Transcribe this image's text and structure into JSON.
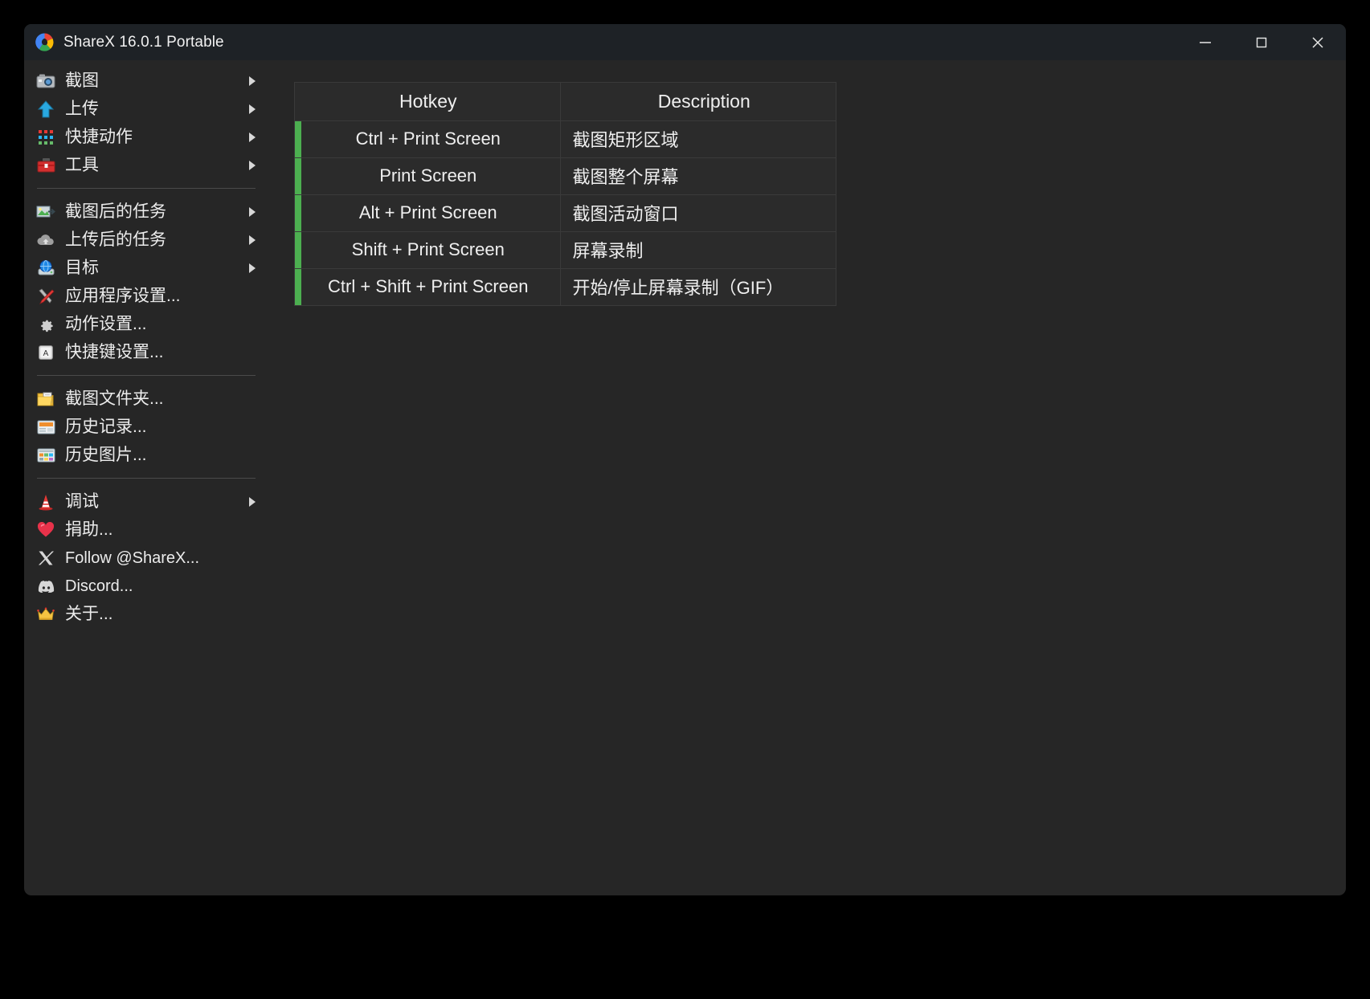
{
  "window": {
    "title": "ShareX 16.0.1 Portable",
    "logo_icon": "sharex-swirl-logo",
    "background_color": "#262626",
    "titlebar_color": "#1e2226",
    "controls": [
      {
        "name": "minimize",
        "icon": "minimize-icon"
      },
      {
        "name": "maximize",
        "icon": "maximize-icon"
      },
      {
        "name": "close",
        "icon": "close-icon"
      }
    ]
  },
  "sidebar": {
    "groups": [
      {
        "items": [
          {
            "label": "截图",
            "icon": "camera-icon",
            "has_submenu": true
          },
          {
            "label": "上传",
            "icon": "upload-arrow-icon",
            "has_submenu": true
          },
          {
            "label": "快捷动作",
            "icon": "color-dots-grid-icon",
            "has_submenu": true
          },
          {
            "label": "工具",
            "icon": "toolbox-icon",
            "has_submenu": true
          }
        ]
      },
      {
        "items": [
          {
            "label": "截图后的任务",
            "icon": "after-capture-icon",
            "has_submenu": true
          },
          {
            "label": "上传后的任务",
            "icon": "cloud-icon",
            "has_submenu": true
          },
          {
            "label": "目标",
            "icon": "destination-globe-icon",
            "has_submenu": true
          },
          {
            "label": "应用程序设置...",
            "icon": "wrench-screwdriver-icon",
            "has_submenu": false
          },
          {
            "label": "动作设置...",
            "icon": "gear-icon",
            "has_submenu": false
          },
          {
            "label": "快捷键设置...",
            "icon": "keyboard-key-icon",
            "has_submenu": false
          }
        ]
      },
      {
        "items": [
          {
            "label": "截图文件夹...",
            "icon": "folder-icon",
            "has_submenu": false
          },
          {
            "label": "历史记录...",
            "icon": "history-list-icon",
            "has_submenu": false
          },
          {
            "label": "历史图片...",
            "icon": "image-history-icon",
            "has_submenu": false
          }
        ]
      },
      {
        "items": [
          {
            "label": "调试",
            "icon": "traffic-cone-icon",
            "has_submenu": true
          },
          {
            "label": "捐助...",
            "icon": "heart-icon",
            "has_submenu": false
          },
          {
            "label": "Follow @ShareX...",
            "icon": "x-twitter-icon",
            "has_submenu": false
          },
          {
            "label": "Discord...",
            "icon": "discord-icon",
            "has_submenu": false
          },
          {
            "label": "关于...",
            "icon": "crown-icon",
            "has_submenu": false
          }
        ]
      }
    ]
  },
  "hotkey_table": {
    "headers": [
      "Hotkey",
      "Description"
    ],
    "row_indicator_color": "#4caf50",
    "rows": [
      {
        "hotkey": "Ctrl + Print Screen",
        "description": "截图矩形区域",
        "status": "active"
      },
      {
        "hotkey": "Print Screen",
        "description": "截图整个屏幕",
        "status": "active"
      },
      {
        "hotkey": "Alt + Print Screen",
        "description": "截图活动窗口",
        "status": "active"
      },
      {
        "hotkey": "Shift + Print Screen",
        "description": "屏幕录制",
        "status": "active"
      },
      {
        "hotkey": "Ctrl + Shift + Print Screen",
        "description": "开始/停止屏幕录制（GIF）",
        "status": "active"
      }
    ]
  }
}
